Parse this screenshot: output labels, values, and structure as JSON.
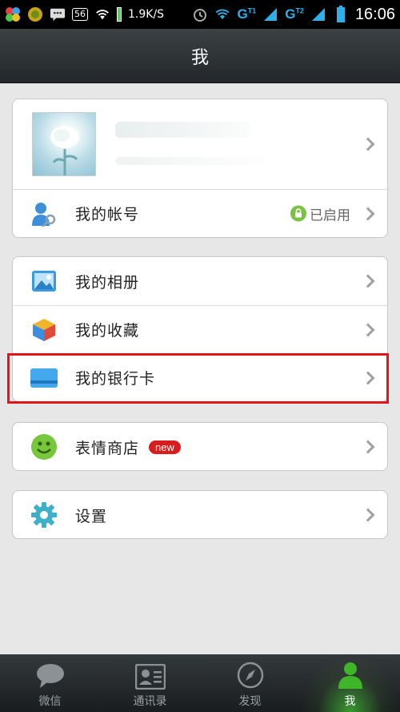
{
  "status_bar": {
    "net_speed": "1.9K/S",
    "badge": "56",
    "sim1": "G",
    "sim1_tag": "T1",
    "sim2": "G",
    "sim2_tag": "T2",
    "time": "16:06"
  },
  "header": {
    "title": "我"
  },
  "account": {
    "label": "我的帐号",
    "status": "已启用"
  },
  "menu1": [
    {
      "label": "我的相册",
      "icon": "photo-album-icon"
    },
    {
      "label": "我的收藏",
      "icon": "favorites-cube-icon"
    },
    {
      "label": "我的银行卡",
      "icon": "bank-card-icon"
    }
  ],
  "stickers": {
    "label": "表情商店",
    "badge": "new"
  },
  "settings": {
    "label": "设置"
  },
  "tabs": [
    {
      "label": "微信",
      "icon": "chat-bubble-icon"
    },
    {
      "label": "通讯录",
      "icon": "contacts-card-icon"
    },
    {
      "label": "发现",
      "icon": "compass-icon"
    },
    {
      "label": "我",
      "icon": "person-icon"
    }
  ],
  "colors": {
    "accent_green": "#3fb62a",
    "highlight_red": "#e3151b",
    "new_badge": "#d71d1d"
  }
}
